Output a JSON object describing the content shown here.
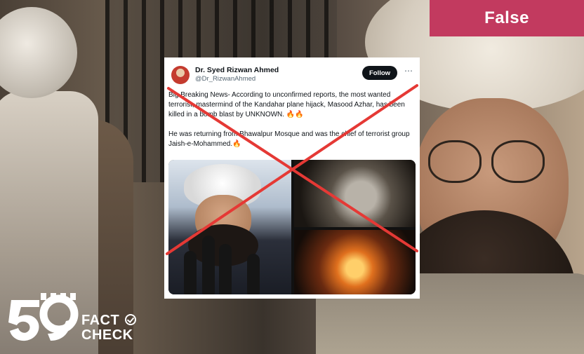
{
  "verdict": {
    "label": "False",
    "color": "#c23a5f"
  },
  "tweet": {
    "author_name": "Dr. Syed Rizwan Ahmed",
    "author_handle": "@Dr_RizwanAhmed",
    "follow_label": "Follow",
    "more_icon": "more-icon",
    "paragraphs": [
      "Big Breaking News- According to unconfirmed reports, the most wanted terrorist, mastermind of the Kandahar plane hijack, Masood Azhar, has been killed in a bomb blast by UNKNOWN. 🔥🔥",
      "He was returning from Bhawalpur Mosque and was the chief of terrorist group Jaish-e-Mohammed.🔥"
    ],
    "cross_color": "#e53935"
  },
  "logo": {
    "line1": "FACT",
    "line2": "CHECK"
  }
}
